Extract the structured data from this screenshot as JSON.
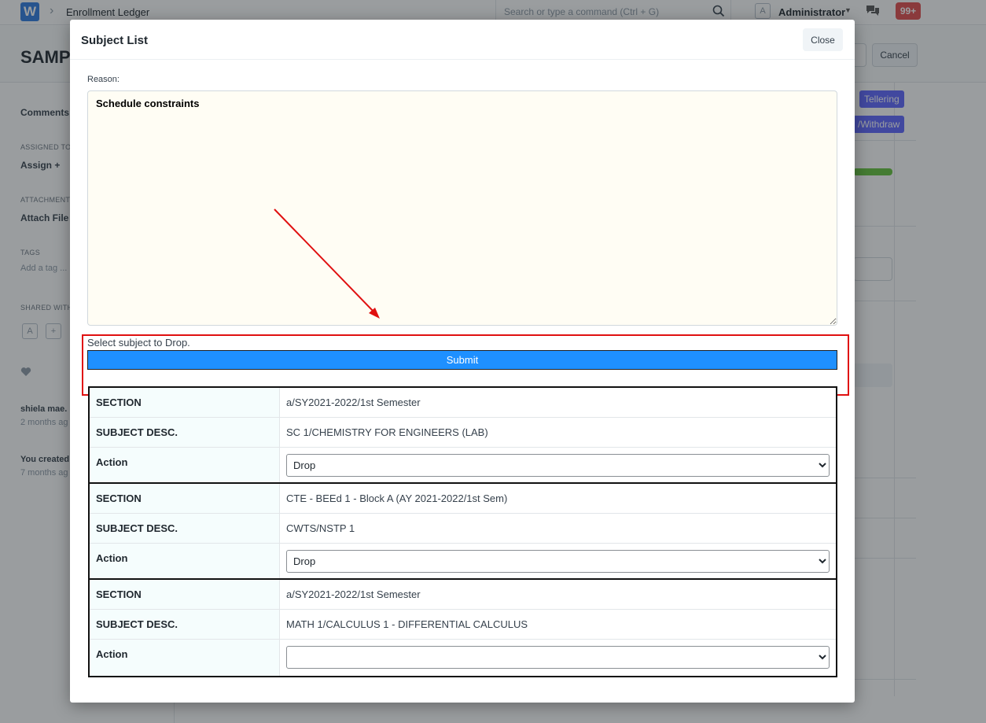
{
  "app": {
    "logo": "W",
    "breadcrumb": "Enrollment Ledger",
    "search_placeholder": "Search or type a command (Ctrl + G)",
    "user_initial": "A",
    "user_name": "Administrator",
    "notifications": "99+",
    "page_title": "SAMP",
    "cancel_label": "Cancel"
  },
  "sidebar": {
    "comments": "Comments",
    "assigned_to": "ASSIGNED TO",
    "assign": "Assign +",
    "attachments": "ATTACHMENT",
    "attach_file": "Attach File",
    "tags": "TAGS",
    "add_tag": "Add a tag ...",
    "shared_with": "SHARED WITH",
    "shared_avatar": "A",
    "shared_add": "+",
    "activity_user": "shiela mae.",
    "activity_time": "2 months ag",
    "created_by": "You created",
    "created_time": "7 months ag"
  },
  "right_panel": {
    "tellering": "Tellering",
    "withdraw": "/Withdraw"
  },
  "modal": {
    "title": "Subject List",
    "close_label": "Close",
    "reason_label": "Reason:",
    "reason_value": "Schedule constraints",
    "select_hint": "Select subject to Drop.",
    "submit_label": "Submit",
    "field_labels": {
      "section": "SECTION",
      "subject_desc": "SUBJECT DESC.",
      "action": "Action"
    },
    "subjects": [
      {
        "section": "a/SY2021-2022/1st Semester",
        "subject_desc": "SC 1/CHEMISTRY FOR ENGINEERS (LAB)",
        "action": "Drop"
      },
      {
        "section": "CTE - BEEd 1 - Block A (AY 2021-2022/1st Sem)",
        "subject_desc": "CWTS/NSTP 1",
        "action": "Drop"
      },
      {
        "section": "a/SY2021-2022/1st Semester",
        "subject_desc": "MATH 1/CALCULUS 1 - DIFFERENTIAL CALCULUS",
        "action": ""
      }
    ]
  },
  "colors": {
    "submit": "#1e90ff",
    "highlight": "#e01010",
    "notif": "#e24c4c",
    "tag": "#5e64ff"
  }
}
